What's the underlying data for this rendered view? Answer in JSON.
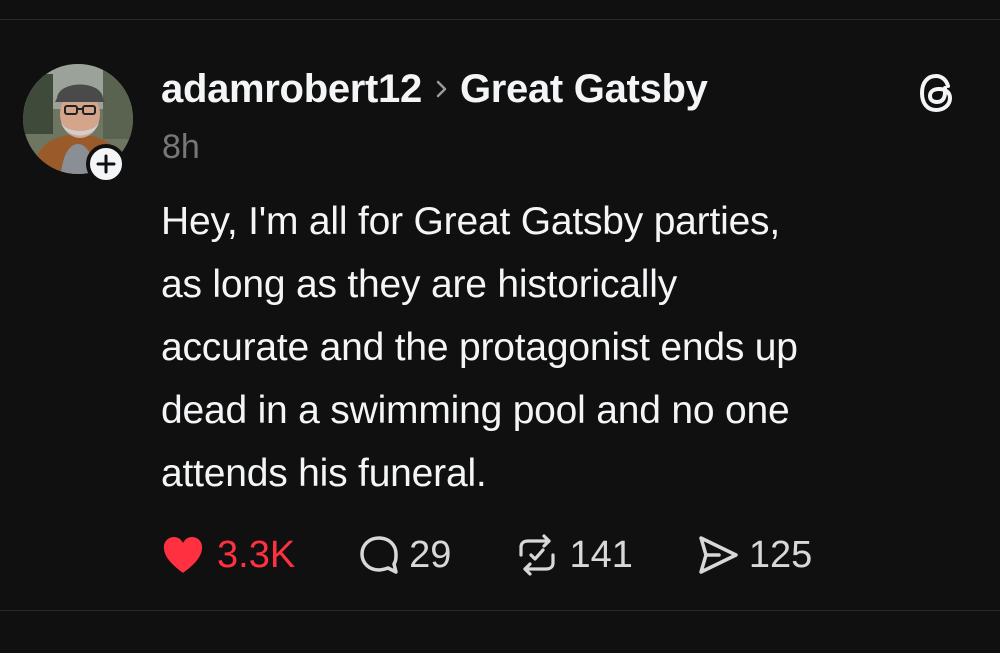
{
  "post": {
    "username": "adamrobert12",
    "topic": "Great Gatsby",
    "time_ago": "8h",
    "body_lines": [
      "Hey, I'm all for Great Gatsby parties,",
      "as long as they are historically",
      "accurate and the protagonist ends up",
      "dead in a swimming pool and no one",
      "attends his funeral."
    ]
  },
  "actions": {
    "likes": "3.3K",
    "replies": "29",
    "reposts": "141",
    "shares": "125"
  },
  "colors": {
    "background": "#101010",
    "text": "#f3f5f7",
    "muted": "#777777",
    "like": "#ff3040"
  },
  "icons": {
    "follow": "plus-icon",
    "separator": "chevron-right-icon",
    "logo": "threads-logo-icon",
    "like": "heart-filled-icon",
    "reply": "speech-bubble-icon",
    "repost": "repost-icon",
    "share": "send-icon"
  }
}
